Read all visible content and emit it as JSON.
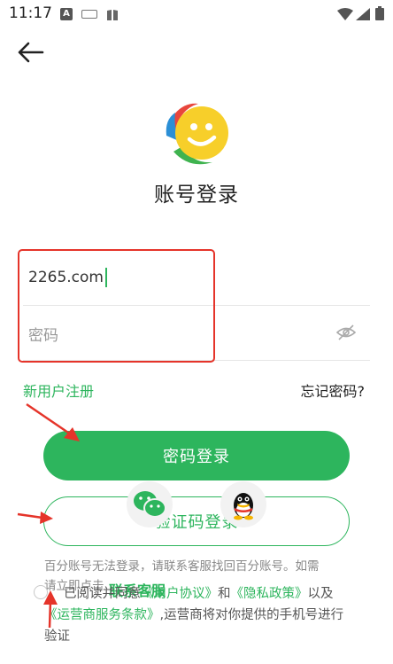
{
  "status_bar": {
    "time": "11:17",
    "keyboard_badge": "A",
    "icons": [
      "keyboard-icon",
      "book-icon",
      "wifi-icon",
      "signal-icon",
      "battery-icon"
    ]
  },
  "header": {
    "back_icon": "back-arrow-icon"
  },
  "page": {
    "title": "账号登录"
  },
  "form": {
    "account_value": "2265.com",
    "password_placeholder": "密码",
    "password_toggle_icon": "eye-off-icon"
  },
  "links": {
    "register": "新用户注册",
    "forgot": "忘记密码?"
  },
  "buttons": {
    "password_login": "密码登录",
    "code_login": "验证码登录"
  },
  "social": [
    "wechat-icon",
    "qq-icon"
  ],
  "notice": {
    "text_a": "百分账号无法登录，请联系客服找回百分账号。如需",
    "text_b": "请立即点击",
    "contact_link": "联系客服"
  },
  "agreement": {
    "prefix": "已阅读并同意",
    "user_agreement": "《用户协议》",
    "and": "和",
    "privacy_policy": "《隐私政策》",
    "and2": "以及",
    "carrier_terms": "《运营商服务条款》",
    "suffix": ",运营商将对你提供的手机号进行验证"
  },
  "colors": {
    "accent": "#2db55d",
    "annotation": "#e5342a",
    "muted_text": "#888888"
  }
}
